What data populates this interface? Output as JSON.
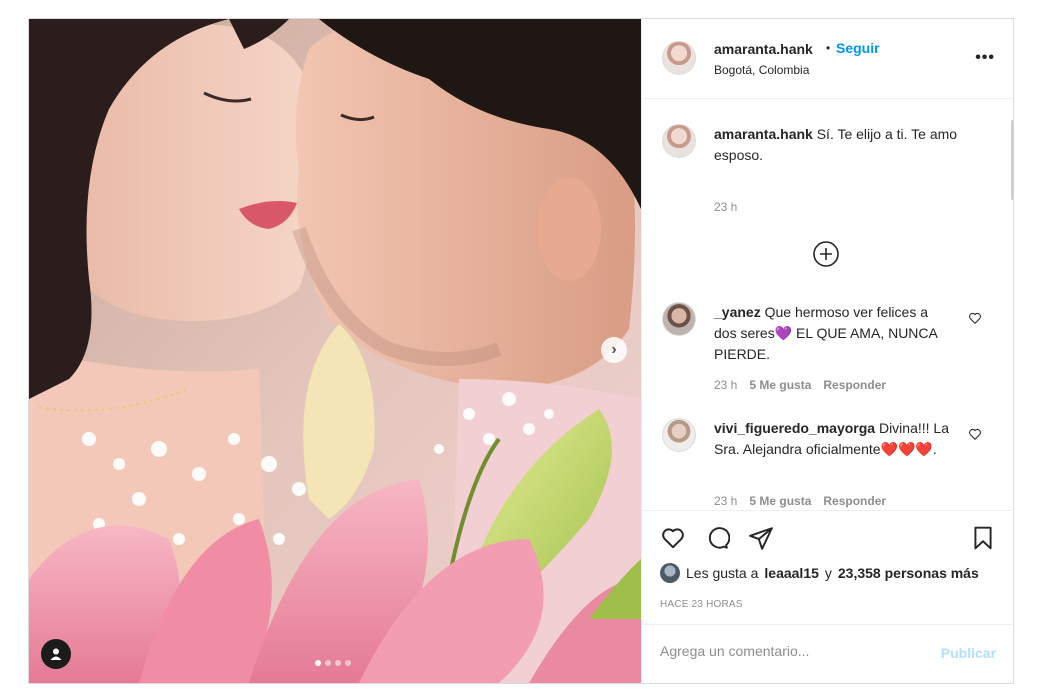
{
  "header": {
    "username": "amaranta.hank",
    "separator": "•",
    "follow_label": "Seguir",
    "location": "Bogotá, Colombia",
    "more_label": "•••"
  },
  "caption": {
    "username": "amaranta.hank",
    "text": "Sí. Te elijo a ti. Te amo esposo.",
    "time": "23 h"
  },
  "comments": [
    {
      "username": "_yanez",
      "text": "Que hermoso ver felices a dos seres💜 EL QUE AMA, NUNCA PIERDE.",
      "time": "23 h",
      "likes": "5 Me gusta",
      "reply": "Responder"
    },
    {
      "username": "vivi_figueredo_mayorga",
      "text": "Divina!!! La Sra. Alejandra oficialmente❤️❤️❤️.",
      "time": "23 h",
      "likes": "5 Me gusta",
      "reply": "Responder"
    }
  ],
  "likes": {
    "prefix": "Les gusta a",
    "user": "leaaal15",
    "middle": "y",
    "count": "23,358 personas más"
  },
  "time_ago": "HACE 23 HORAS",
  "add_comment": {
    "placeholder": "Agrega un comentario...",
    "publish_label": "Publicar"
  },
  "carousel": {
    "slides": 4,
    "active_index": 0,
    "next_label": "›"
  },
  "colors": {
    "link_blue": "#0095f6",
    "publish_disabled": "#b2dffc",
    "meta_gray": "#8e8e8e"
  },
  "icons": [
    "heart-icon",
    "comment-icon",
    "share-icon",
    "save-icon",
    "add-circle-icon",
    "more-options-icon",
    "tag-user-icon",
    "next-arrow-icon"
  ]
}
